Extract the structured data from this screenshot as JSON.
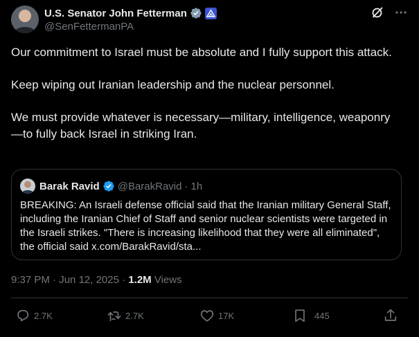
{
  "author": {
    "display_name": "U.S. Senator John Fetterman",
    "handle": "@SenFettermanPA",
    "verified_icon": "verified-badge-icon",
    "affiliation_icon": "government-badge-icon"
  },
  "post": {
    "paragraphs": [
      "Our commitment to Israel must be absolute and I fully support this attack.",
      "Keep wiping out Iranian leadership and the nuclear personnel.",
      "We must provide whatever is necessary—military, intelligence, weaponry—to fully back Israel in striking Iran."
    ],
    "time": "9:37 PM",
    "date": "Jun 12, 2025",
    "separator": "·",
    "views_count": "1.2M",
    "views_label": "Views"
  },
  "quoted_post": {
    "display_name": "Barak Ravid",
    "handle": "@BarakRavid",
    "separator": "·",
    "age": "1h",
    "text": "BREAKING: An Israeli defense official said that the Iranian military General Staff, including the Iranian Chief of Staff and senior nuclear scientists were targeted in the Israeli strikes. \"There is increasing likelihood that they were all eliminated\", the official said x.com/BarakRavid/sta..."
  },
  "actions": {
    "reply_count": "2.7K",
    "repost_count": "2.7K",
    "like_count": "17K",
    "bookmark_count": "445"
  },
  "colors": {
    "background": "#000000",
    "text_primary": "#e7e9ea",
    "text_secondary": "#71767b",
    "border": "#2f3336",
    "verified_blue": "#1d9bf0"
  }
}
